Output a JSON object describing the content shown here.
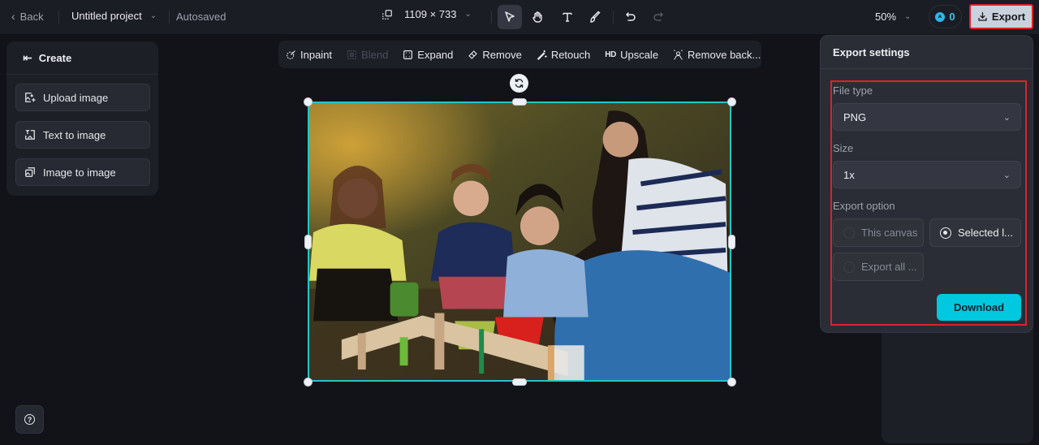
{
  "topbar": {
    "back_label": "Back",
    "project_name": "Untitled project",
    "save_status": "Autosaved",
    "canvas_size": "1109 × 733",
    "tools": [
      {
        "name": "select",
        "active": true
      },
      {
        "name": "hand",
        "active": false
      },
      {
        "name": "text",
        "active": false
      },
      {
        "name": "brush",
        "active": false
      },
      {
        "name": "undo",
        "active": false
      },
      {
        "name": "redo",
        "active": false,
        "disabled": true
      }
    ],
    "zoom_level": "50%",
    "credits": "0",
    "export_label": "Export"
  },
  "left_panel": {
    "title": "Create",
    "items": [
      {
        "label": "Upload image"
      },
      {
        "label": "Text to image"
      },
      {
        "label": "Image to image"
      }
    ]
  },
  "edit_toolbar": {
    "items": [
      {
        "label": "Inpaint",
        "enabled": true
      },
      {
        "label": "Blend",
        "enabled": false
      },
      {
        "label": "Expand",
        "enabled": true
      },
      {
        "label": "Remove",
        "enabled": true
      },
      {
        "label": "Retouch",
        "enabled": true
      },
      {
        "label": "Upscale",
        "badge": "HD",
        "enabled": true
      },
      {
        "label": "Remove back...",
        "enabled": true
      }
    ]
  },
  "canvas": {
    "image_description": "Woman and three young girls gardening outdoors in autumn with pots and wooden planter"
  },
  "export_settings": {
    "title": "Export settings",
    "file_type_label": "File type",
    "file_type_value": "PNG",
    "size_label": "Size",
    "size_value": "1x",
    "export_option_label": "Export option",
    "options": [
      {
        "label": "This canvas",
        "selected": false
      },
      {
        "label": "Selected l...",
        "selected": true
      },
      {
        "label": "Export all ...",
        "selected": false
      }
    ],
    "download_label": "Download"
  },
  "colors": {
    "accent": "#00c8df",
    "selection": "#1fc8c8",
    "highlight": "#e0202a",
    "background": "#121318",
    "panel": "#1d1f27"
  }
}
